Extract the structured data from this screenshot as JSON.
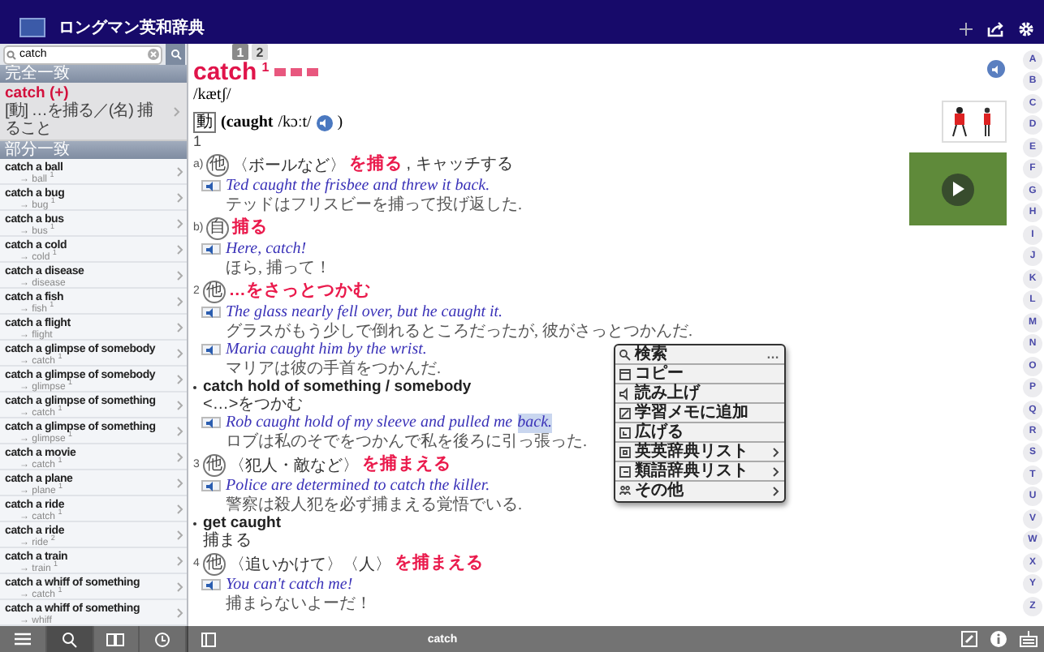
{
  "app_bar": {
    "title": "ロングマン英和辞典"
  },
  "search": {
    "value": "catch"
  },
  "sidebar": {
    "exact_header": "完全一致",
    "exact_results": [
      {
        "word": "catch (+)",
        "gloss": "[動] …を捕る／(名) 捕ること",
        "selected": true
      }
    ],
    "partial_header": "部分一致",
    "partial_results": [
      {
        "phrase": "catch a ball",
        "ref": "→ ball $^{1}$"
      },
      {
        "phrase": "catch a bug",
        "ref": "→ bug $^{1}$"
      },
      {
        "phrase": "catch a bus",
        "ref": "→ bus $^{1}$"
      },
      {
        "phrase": "catch a cold",
        "ref": "→ cold $^{1}$"
      },
      {
        "phrase": "catch a disease",
        "ref": "→ disease"
      },
      {
        "phrase": "catch a fish",
        "ref": "→ fish $^{1}$"
      },
      {
        "phrase": "catch a flight",
        "ref": "→ flight"
      },
      {
        "phrase": "catch a glimpse of somebody",
        "ref": "→ catch $^{1}$"
      },
      {
        "phrase": "catch a glimpse of somebody",
        "ref": "→ glimpse $^{1}$"
      },
      {
        "phrase": "catch a glimpse of something",
        "ref": "→ catch $^{1}$"
      },
      {
        "phrase": "catch a glimpse of something",
        "ref": "→ glimpse $^{1}$"
      },
      {
        "phrase": "catch a movie",
        "ref": "→ catch $^{1}$"
      },
      {
        "phrase": "catch a plane",
        "ref": "→ plane $^{1}$"
      },
      {
        "phrase": "catch a ride",
        "ref": "→ catch $^{1}$"
      },
      {
        "phrase": "catch a ride",
        "ref": "→ ride $^{2}$"
      },
      {
        "phrase": "catch a train",
        "ref": "→ train $^{1}$"
      },
      {
        "phrase": "catch a whiff of something",
        "ref": "→ catch $^{1}$"
      },
      {
        "phrase": "catch a whiff of something",
        "ref": "→ whiff"
      }
    ]
  },
  "sidebar_toolbar": [
    {
      "selected": false
    },
    {
      "selected": true
    },
    {
      "selected": false
    },
    {
      "selected": false
    }
  ],
  "entry": {
    "page_tabs": [
      {
        "label": "1",
        "selected": true
      },
      {
        "label": "2",
        "selected": false
      }
    ],
    "headword": "catch",
    "homograph": "1",
    "pronunciation": "/kætʃ/",
    "inflection": {
      "pos": "動",
      "form": "(caught",
      "pron": "/kɔːt/",
      "close": ")"
    },
    "blocks": [
      {
        "kind": "number",
        "num": "1"
      },
      {
        "kind": "sense",
        "num": "a)",
        "pos": "他",
        "gloss": "〈ボールなど〉",
        "def": "を捕る",
        "rest": ", キャッチする"
      },
      {
        "kind": "example",
        "en": "Ted caught the frisbee and threw it back.",
        "ja": "テッドはフリスビーを捕って投げ返した."
      },
      {
        "kind": "sense",
        "num": "b)",
        "pos": "自",
        "def": "捕る"
      },
      {
        "kind": "example",
        "en": "Here, catch!",
        "ja": "ほら, 捕って！"
      },
      {
        "kind": "sense",
        "num": "2",
        "pos": "他",
        "def": "…をさっとつかむ"
      },
      {
        "kind": "example",
        "en": "The glass nearly fell over, but he caught it.",
        "ja": "グラスがもう少しで倒れるところだったが, 彼がさっとつかんだ."
      },
      {
        "kind": "example",
        "en": "Maria caught him by the wrist.",
        "ja": "マリアは彼の手首をつかんだ."
      },
      {
        "kind": "idiom",
        "phrase": "catch hold of something / somebody",
        "meaning": "<…>をつかむ"
      },
      {
        "kind": "example",
        "en": "Rob caught hold of my sleeve and pulled me",
        "highlight": "back.",
        "ja": "ロブは私のそでをつかんで私を後ろに引っ張った."
      },
      {
        "kind": "sense",
        "num": "3",
        "pos": "他",
        "gloss": "〈犯人・敵など〉",
        "def": "を捕まえる"
      },
      {
        "kind": "example",
        "en": "Police are determined to catch the killer.",
        "ja": "警察は殺人犯を必ず捕まえる覚悟でいる."
      },
      {
        "kind": "idiom",
        "phrase": "get caught",
        "meaning": "捕まる"
      },
      {
        "kind": "sense",
        "num": "4",
        "pos": "他",
        "gloss": "〈追いかけて〉〈人〉",
        "def": "を捕まえる"
      },
      {
        "kind": "example",
        "en": "You can't catch me!",
        "ja": "捕まらないよーだ！"
      }
    ]
  },
  "popup_menu": [
    {
      "label": "検索",
      "kind": "more",
      "extra": "…"
    },
    {
      "label": "コピー",
      "kind": "plain"
    },
    {
      "label": "読み上げ",
      "kind": "plain"
    },
    {
      "label": "学習メモに追加",
      "kind": "plain"
    },
    {
      "label": "広げる",
      "kind": "plain"
    },
    {
      "label": "英英辞典リスト",
      "kind": "submenu"
    },
    {
      "label": "類語辞典リスト",
      "kind": "submenu"
    },
    {
      "label": "その他",
      "kind": "submenu"
    }
  ],
  "footer": {
    "query": "catch"
  },
  "index_letters": [
    "A",
    "B",
    "C",
    "D",
    "E",
    "F",
    "G",
    "H",
    "I",
    "J",
    "K",
    "L",
    "M",
    "N",
    "O",
    "P",
    "Q",
    "R",
    "S",
    "T",
    "U",
    "V",
    "W",
    "X",
    "Y",
    "Z"
  ]
}
